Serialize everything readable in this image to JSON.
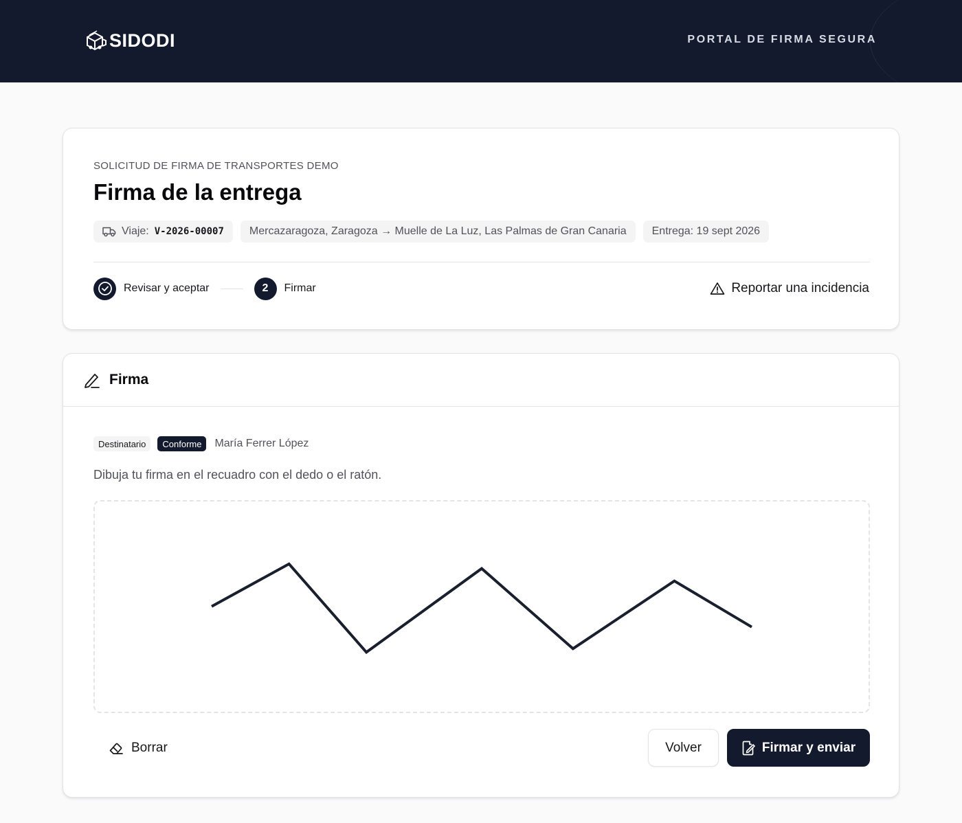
{
  "header": {
    "brand": "SIDODI",
    "portal_label": "PORTAL DE FIRMA SEGURA",
    "logo_icon": "truck-logo-icon"
  },
  "request": {
    "eyebrow_prefix": "SOLICITUD DE FIRMA DE",
    "eyebrow_company": "TRANSPORTES DEMO",
    "title": "Firma de la entrega",
    "trip_label": "Viaje:",
    "trip_code": "V-2026-00007",
    "route": "Mercazaragoza, Zaragoza → Muelle de La Luz, Las Palmas de Gran Canaria",
    "delivery": "Entrega: 19 sept 2026"
  },
  "steps": [
    {
      "label": "Revisar y aceptar",
      "state": "done",
      "icon": "check-circle-icon"
    },
    {
      "number": "2",
      "label": "Firmar",
      "state": "current"
    }
  ],
  "report_link": "Reportar una incidencia",
  "signature": {
    "heading": "Firma",
    "role_badge": "Destinatario",
    "status_badge": "Conforme",
    "signer_name": "María Ferrer López",
    "instructions": "Dibuja tu firma en el recuadro con el dedo o el ratón.",
    "stroke_color": "#1a1f2e",
    "stroke": [
      [
        0.151,
        0.499
      ],
      [
        0.251,
        0.297
      ],
      [
        0.351,
        0.717
      ],
      [
        0.5,
        0.319
      ],
      [
        0.618,
        0.7
      ],
      [
        0.749,
        0.378
      ],
      [
        0.849,
        0.597
      ]
    ],
    "clear_label": "Borrar",
    "back_label": "Volver",
    "submit_label": "Firmar y enviar"
  },
  "colors": {
    "navy": "#131a2e",
    "border": "#e4e4e7",
    "muted": "#52525b",
    "page_bg": "#fafafa"
  }
}
